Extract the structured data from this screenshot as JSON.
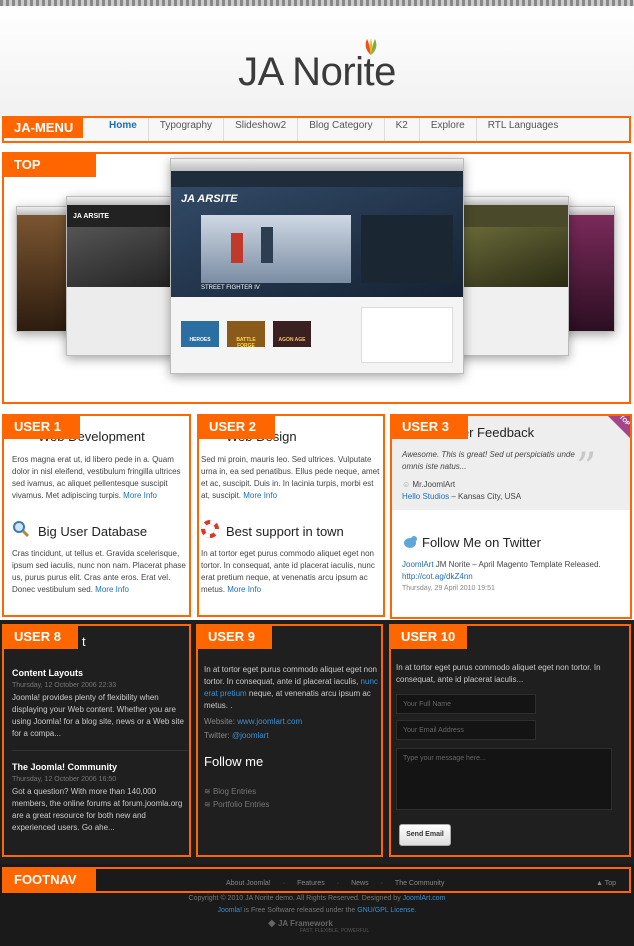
{
  "logo": {
    "title": "JA Norite"
  },
  "positions": {
    "menu": "JA-MENU",
    "top": "TOP",
    "user1": "USER 1",
    "user2": "USER  2",
    "user3": "USER 3",
    "user8": "USER 8",
    "user9": "USER 9",
    "user10": "USER 10",
    "footnav": "FOOTNAV"
  },
  "menu": {
    "items": [
      {
        "label": "Home"
      },
      {
        "label": "Typography"
      },
      {
        "label": "Slideshow2"
      },
      {
        "label": "Blog Category"
      },
      {
        "label": "K2"
      },
      {
        "label": "Explore"
      },
      {
        "label": "RTL Languages"
      }
    ]
  },
  "top": {
    "screenshot_logo": "JA ARSITE",
    "screenshot_caption": "STREET FIGHTER IV",
    "game_titles": [
      "HEROES",
      "BATTLE FORGE",
      "AGON AGE"
    ]
  },
  "user1": {
    "mod1_title": "Web Development",
    "mod1_text": "Eros magna erat ut, id libero pede in a. Quam dolor in nisl eleifend, vestibulum fringilla ultrices sed ivamus, ac aliquet pellentesque suscipit vivamus. Met adipiscing turpis.",
    "mod1_more": "More Info",
    "mod2_title": "Big User Database",
    "mod2_text": "Cras tincidunt, ut tellus et. Gravida scelerisque, ipsum sed iaculis, nunc non nam. Placerat phase us, purus purus elit. Cras ante eros. Erat vel. Donec vestibulum sed.",
    "mod2_more": "More Info"
  },
  "user2": {
    "mod1_title": "Web Design",
    "mod1_text": "Sed mi proin, mauris leo. Sed ultrices. Vulputate urna in, ea sed penatibus. Ellus pede neque, amet et ac, suscipit. Duis in. In lacinia turpis, morbi est at, suscipit.",
    "mod1_more": "More Info",
    "mod2_title": "Best support in town",
    "mod2_text": "In at tortor eget purus commodo aliquet eget non tortor. In consequat, ante id placerat iaculis, nunc erat pretium neque, at venenatis arcu ipsum ac metus.",
    "mod2_more": "More Info"
  },
  "user3": {
    "feedback_title": "User Feedback",
    "top_badge": "TOP",
    "quote": "Awesome. This is great! Sed ut perspiciatis unde omnis iste natus...",
    "author": "Mr.JoomlArt",
    "company": "Hello Studios",
    "location": "– Kansas City, USA",
    "twitter_title": "Follow Me on Twitter",
    "tweet_user": "JoomlArt",
    "tweet_text": "JM Norite – April Magento Template Released.",
    "tweet_link": "http://cot.ag/dkZ4nn",
    "tweet_date": "Thursday, 29 April 2010 19:51"
  },
  "user8": {
    "title_tail": "t",
    "items": [
      {
        "title": "Content Layouts",
        "date": "Thursday, 12 October 2006 22:33",
        "text": "Joomla! provides plenty of flexibility when displaying your Web content. Whether you are using Joomla! for a blog site, news or a Web site for a compa..."
      },
      {
        "title": "The Joomla! Community",
        "date": "Thursday, 12 October 2006 16:50",
        "text": "Got a question? With more than 140,000 members, the online forums at forum.joomla.org are a great resource for both new and experienced users. Go ahe..."
      }
    ]
  },
  "user9": {
    "text_a": "In at tortor eget purus commodo aliquet eget non tortor. In consequat, ante id placerat iaculis,",
    "text_link": "nunc erat pretium",
    "text_b": "neque, at venenatis arcu ipsum ac metus. .",
    "website_label": "Website:",
    "website": "www.joomlart.com",
    "twitter_label": "Twitter:",
    "twitter": "@joomlart",
    "follow_title": "Follow me",
    "links": [
      "Blog Entries",
      "Portfolio Entries"
    ]
  },
  "user10": {
    "text": "In at tortor eget purus commodo aliquet eget non tortor. In consequat, ante id placerat iaculis...",
    "name_placeholder": "Your Full Name",
    "email_placeholder": "Your Email Address",
    "message_placeholder": "Type your message here...",
    "send_label": "Send Email"
  },
  "footer": {
    "nav": [
      "About Joomla!",
      "Features",
      "News",
      "The Community"
    ],
    "top_link": "Top",
    "copyright": "Copyright © 2010 JA Norite demo. All Rights Reserved. Designed by",
    "designer": "JoomlArt.com",
    "free_a": "Joomla!",
    "free_b": "is Free Software released under the",
    "license": "GNU/GPL License.",
    "framework": "JA Framework",
    "framework_tag": "FAST, FLEXIBLE, POWERFUL"
  },
  "colors": {
    "accent": "#ff6600",
    "link": "#1a6fb5",
    "dark_bg": "#1f1f1f"
  }
}
